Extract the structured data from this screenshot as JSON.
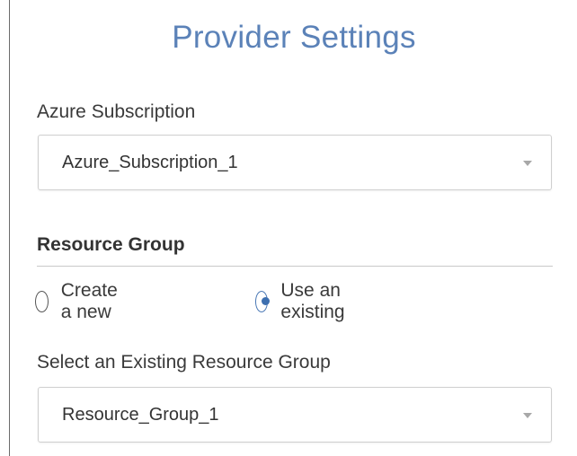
{
  "title": "Provider Settings",
  "subscription": {
    "label": "Azure Subscription",
    "value": "Azure_Subscription_1",
    "icon": "chevron-down-icon"
  },
  "resource_group": {
    "heading": "Resource Group",
    "options": [
      {
        "label": "Create a new",
        "selected": false
      },
      {
        "label": "Use an existing",
        "selected": true
      }
    ],
    "existing_label": "Select an Existing Resource Group",
    "existing_value": "Resource_Group_1",
    "icon": "chevron-down-icon"
  },
  "colors": {
    "title": "#5b82b8",
    "radio_selected": "#3d6fb0"
  }
}
